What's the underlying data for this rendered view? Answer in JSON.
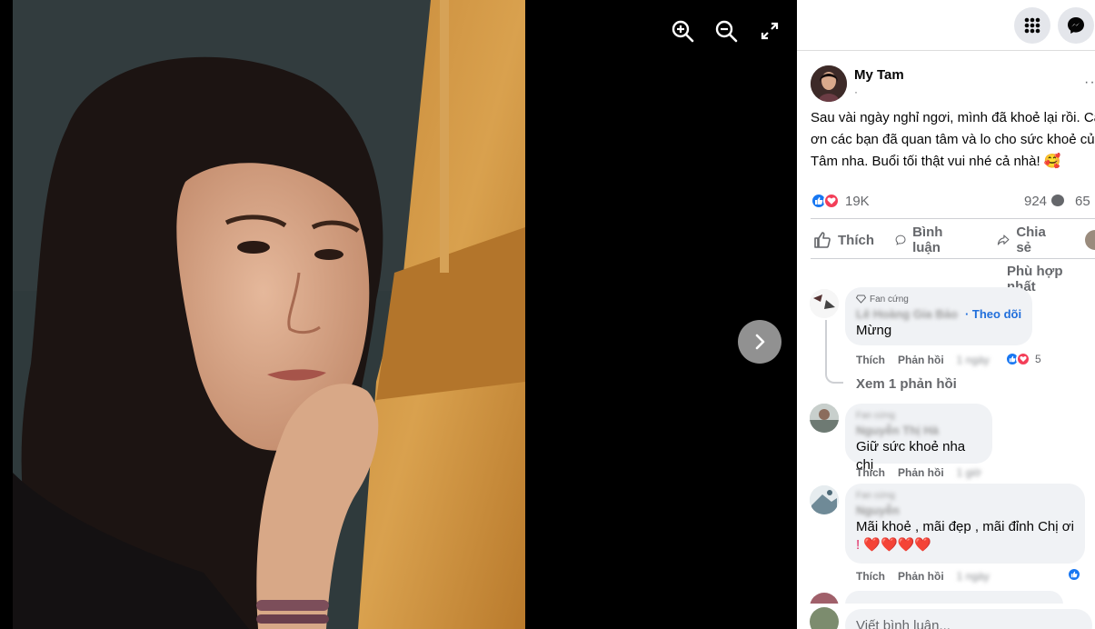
{
  "viewer": {
    "tools": [
      "zoom-in-icon",
      "zoom-out-icon",
      "fullscreen-icon"
    ],
    "next_icon": "chevron-right-icon"
  },
  "topbar": {
    "menu_icon": "grid-menu-icon",
    "messenger_icon": "messenger-icon"
  },
  "post": {
    "author": "My Tam",
    "author_sub": "·",
    "more": "··",
    "text_lines": [
      "Sau vài ngày nghỉ ngơi, mình đã khoẻ lại rồi. Cá",
      "ơn các bạn đã quan tâm và lo cho sức khoẻ của",
      "Tâm nha. Buổi tối thật vui nhé cả nhà! 🥰"
    ],
    "reaction_count": "19K",
    "comment_count": "924",
    "share_count": "65",
    "actions": {
      "like": "Thích",
      "comment": "Bình luận",
      "share": "Chia sẻ"
    },
    "sort_label": "Phù hợp nhất"
  },
  "comments": [
    {
      "badge": "Fan cứng",
      "name": "Lê Hoàng Gia Bảo",
      "follow": "· Theo dõi",
      "text": "Mừng",
      "like": "Thích",
      "reply": "Phản hồi",
      "time": "1 ngày",
      "reactions": "5",
      "view_replies": "Xem 1 phản hồi"
    },
    {
      "badge": "Fan cứng",
      "name": "Nguyễn Thị Hà",
      "text": "Giữ sức khoẻ nha chị",
      "like": "Thích",
      "reply": "Phản hồi",
      "time": "1 giờ"
    },
    {
      "badge": "Fan cứng",
      "name": "Nguyễn",
      "text_line1": "Mãi khoẻ , mãi đẹp , mãi đỉnh Chị ơi",
      "text_line2": "! ❤️❤️❤️❤️",
      "like": "Thích",
      "reply": "Phản hồi",
      "time": "1 ngày"
    }
  ],
  "composer": {
    "placeholder": "Viết bình luận..."
  },
  "colors": {
    "accent": "#1877f2",
    "love": "#f33e58",
    "panel_bg": "#ffffff",
    "bubble": "#f0f2f5"
  }
}
